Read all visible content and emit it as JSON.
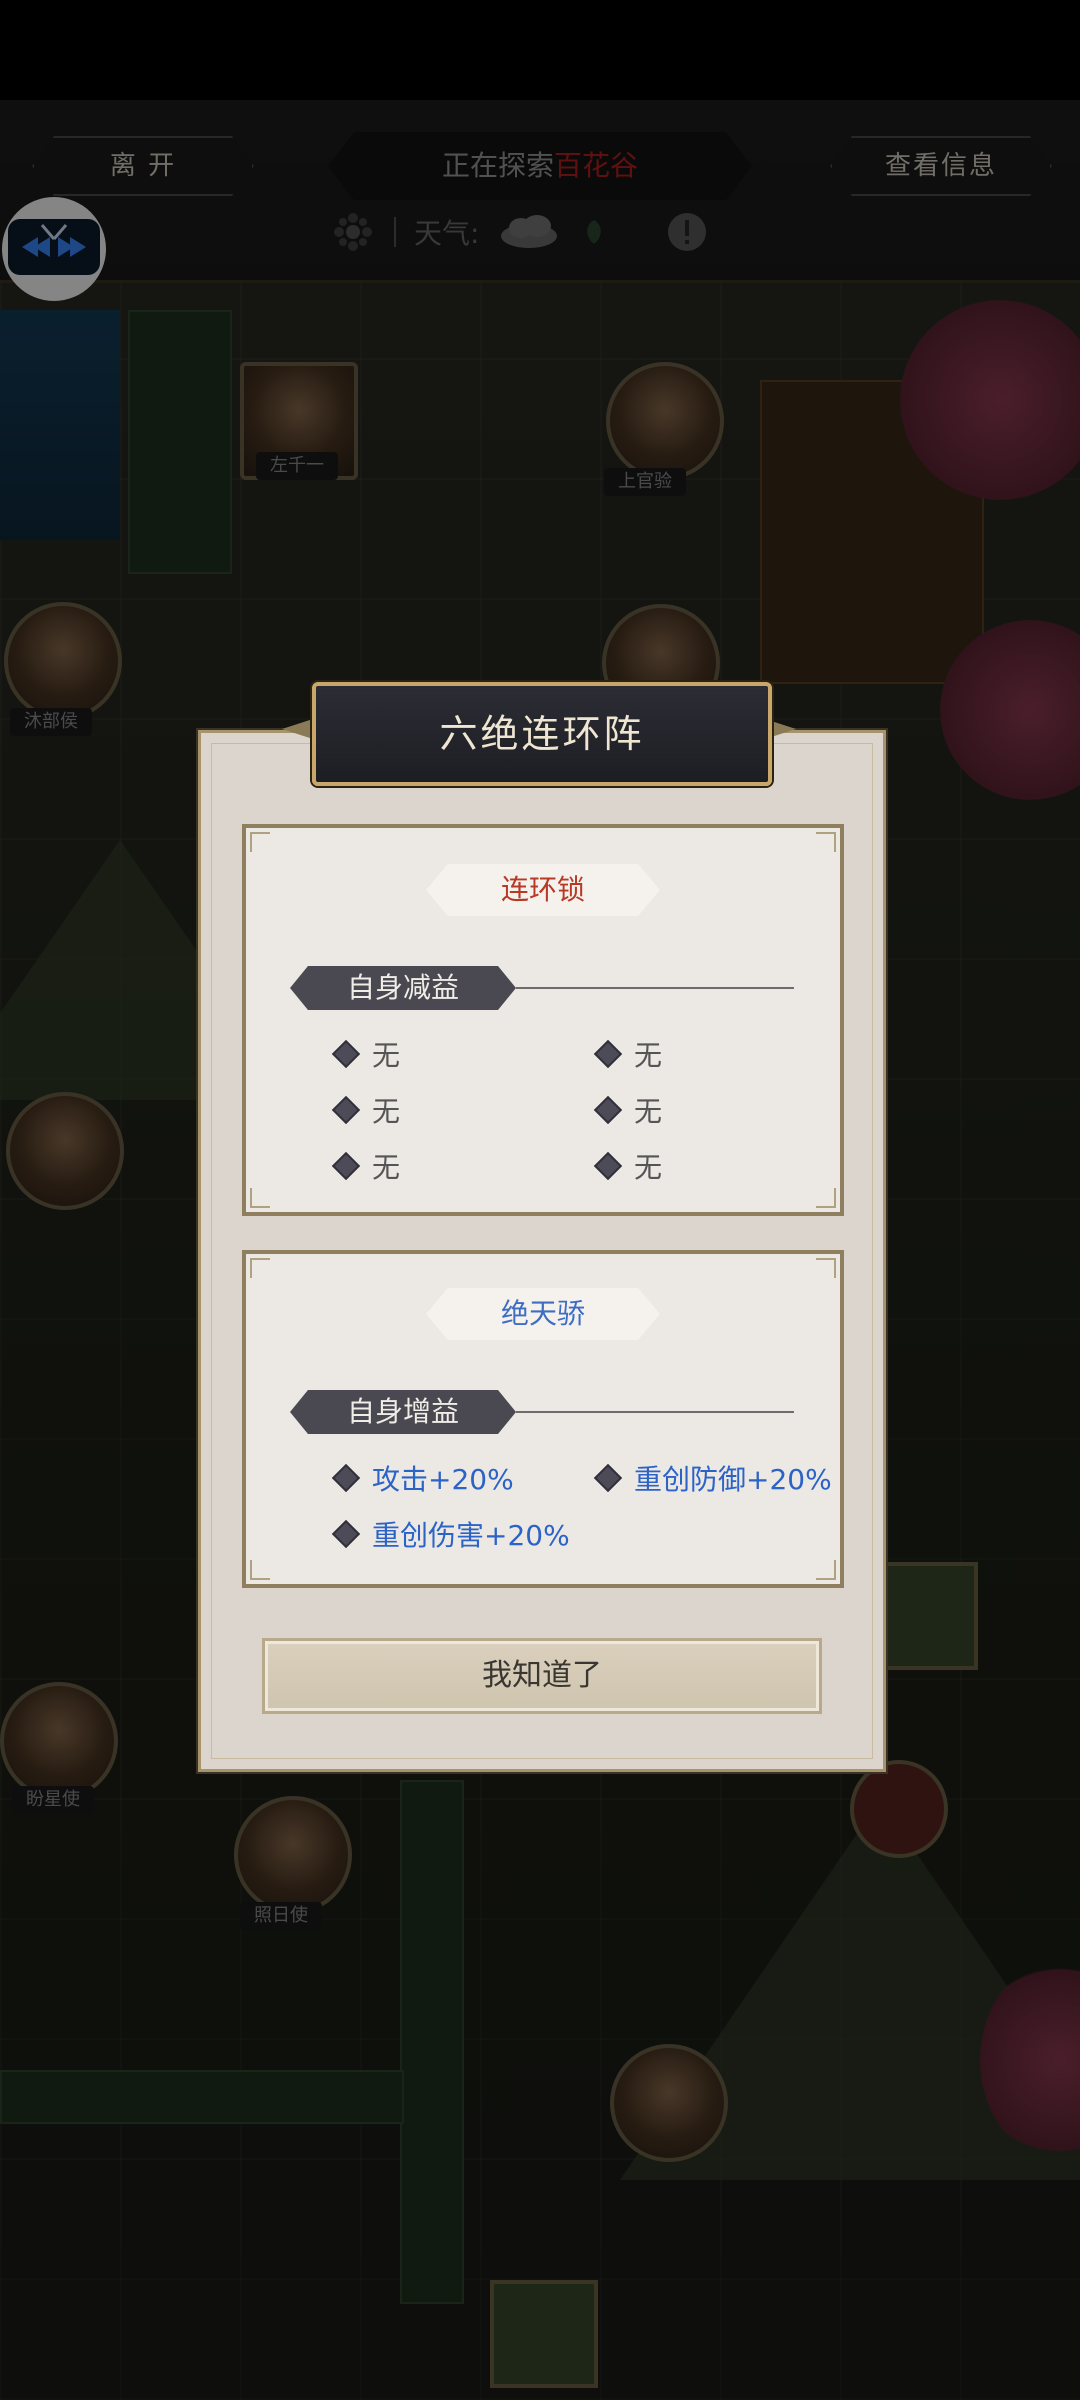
{
  "hud": {
    "leave_label": "离 开",
    "exploring_prefix": "正在探索",
    "location": "百花谷",
    "view_info_label": "查看信息",
    "weather_label": "天气:"
  },
  "map_npcs": [
    {
      "name": "左千一"
    },
    {
      "name": "上官验"
    },
    {
      "name": "沐部侯"
    },
    {
      "name": "盼星使"
    },
    {
      "name": "照日使"
    }
  ],
  "dialog": {
    "title": "六绝连环阵",
    "debuff_card": {
      "ribbon": "连环锁",
      "section": "自身减益",
      "items": [
        "无",
        "无",
        "无",
        "无",
        "无",
        "无"
      ]
    },
    "buff_card": {
      "ribbon": "绝天骄",
      "section": "自身增益",
      "items": [
        "攻击+20%",
        "重创防御+20%",
        "重创伤害+20%"
      ]
    },
    "confirm_label": "我知道了"
  },
  "colors": {
    "location_red": "#b71f1f",
    "buff_blue": "#2c63c7",
    "debuff_ribbon_red": "#b63a25"
  }
}
